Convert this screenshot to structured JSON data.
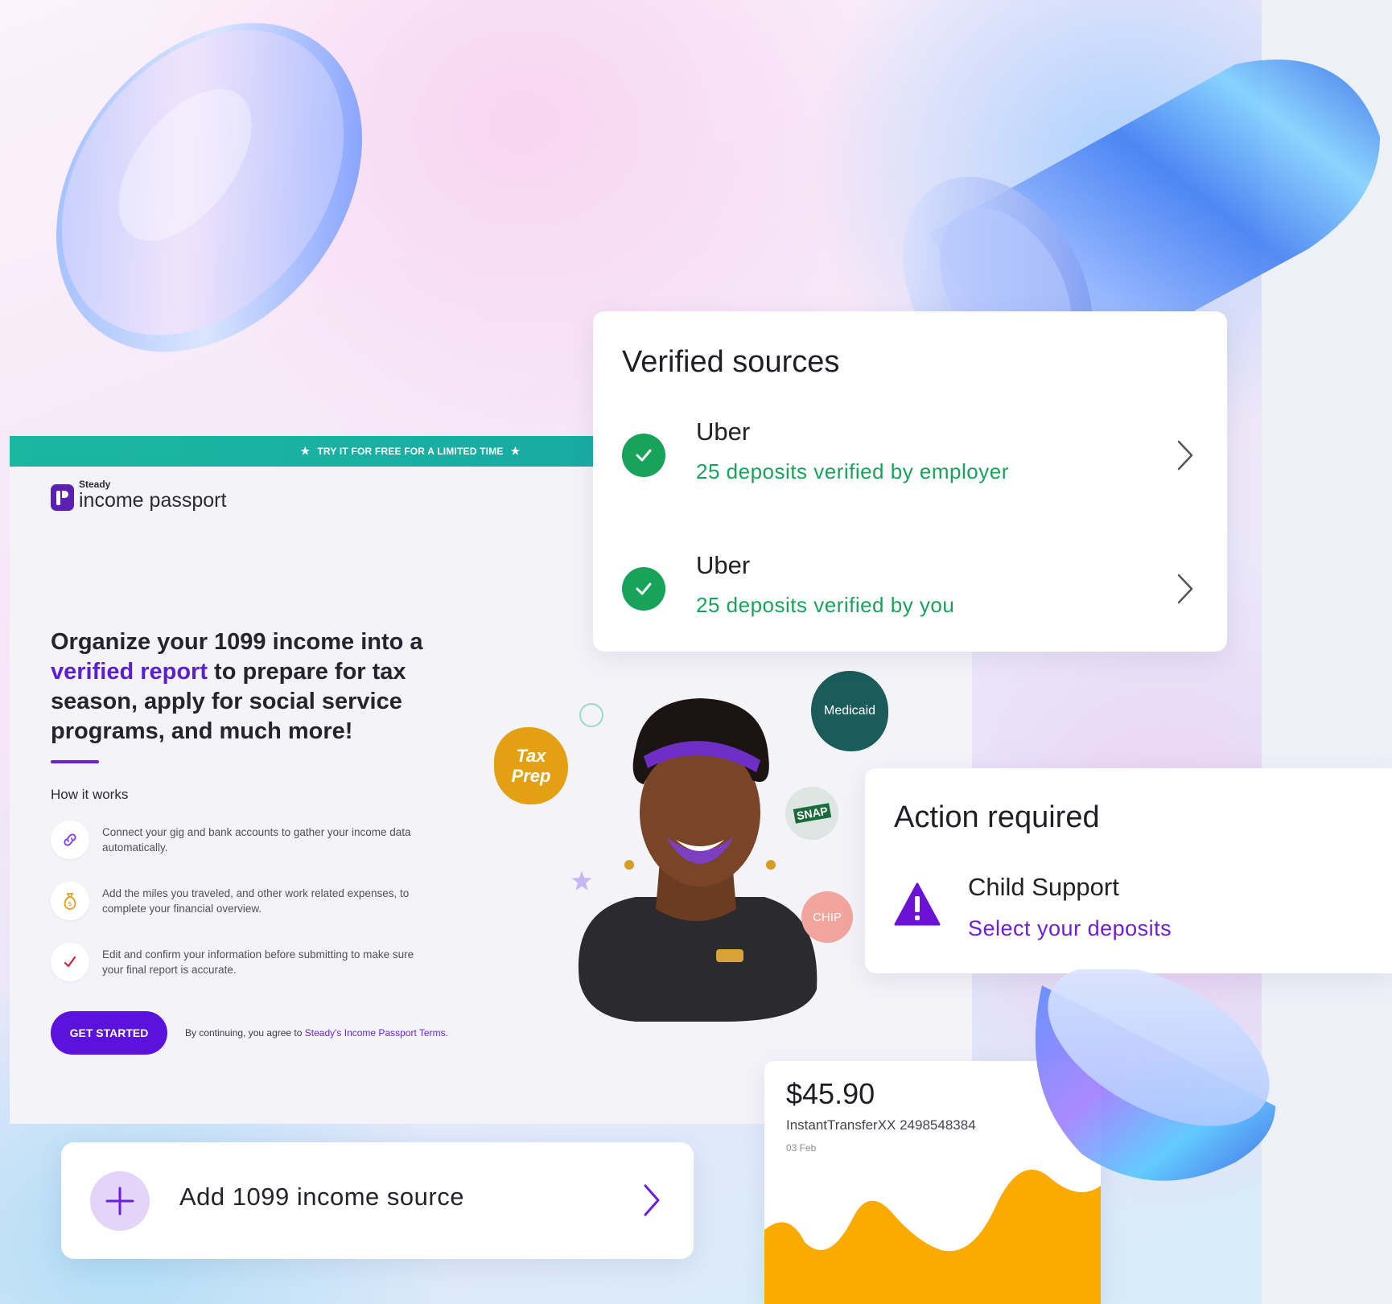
{
  "promo": {
    "text": "TRY IT FOR FREE FOR A LIMITED TIME",
    "star": "★"
  },
  "brand": {
    "small": "Steady",
    "name": "income passport"
  },
  "hero": {
    "heading_pre": "Organize your 1099 income into a ",
    "heading_highlight": "verified report",
    "heading_post": " to prepare for tax season, apply for social service programs, and much more!"
  },
  "how_it_works": {
    "title": "How it works",
    "steps": [
      {
        "icon": "link-icon",
        "text": "Connect your gig and bank accounts to gather your income data automatically."
      },
      {
        "icon": "money-bag-icon",
        "text": "Add the miles you traveled, and other work related expenses, to complete your financial overview."
      },
      {
        "icon": "checkmark-icon",
        "text": "Edit and confirm your information before submitting to make sure your final report is accurate."
      }
    ]
  },
  "cta": {
    "button": "GET STARTED",
    "terms_pre": "By continuing, you agree to ",
    "terms_link": "Steady's Income Passport Terms",
    "terms_post": "."
  },
  "verified_sources": {
    "title": "Verified sources",
    "items": [
      {
        "name": "Uber",
        "status": "25 deposits verified by employer"
      },
      {
        "name": "Uber",
        "status": "25 deposits verified by you"
      }
    ]
  },
  "action_required": {
    "title": "Action required",
    "item_name": "Child Support",
    "item_link": "Select your deposits"
  },
  "add_source": {
    "label": "Add 1099 income source"
  },
  "transaction": {
    "amount": "$45.90",
    "description": "InstantTransferXX 2498548384",
    "date": "03 Feb"
  },
  "illustration": {
    "badges": {
      "tax_line1": "Tax",
      "tax_line2": "Prep",
      "medicaid": "Medicaid",
      "snap": "SNAP",
      "chip": "CHIP"
    }
  },
  "colors": {
    "brand_purple": "#5b12dc",
    "promo_teal": "#1bb7a1",
    "verified_green": "#17a35a",
    "action_purple": "#6b1fd8",
    "chart_orange": "#fbaa00"
  }
}
